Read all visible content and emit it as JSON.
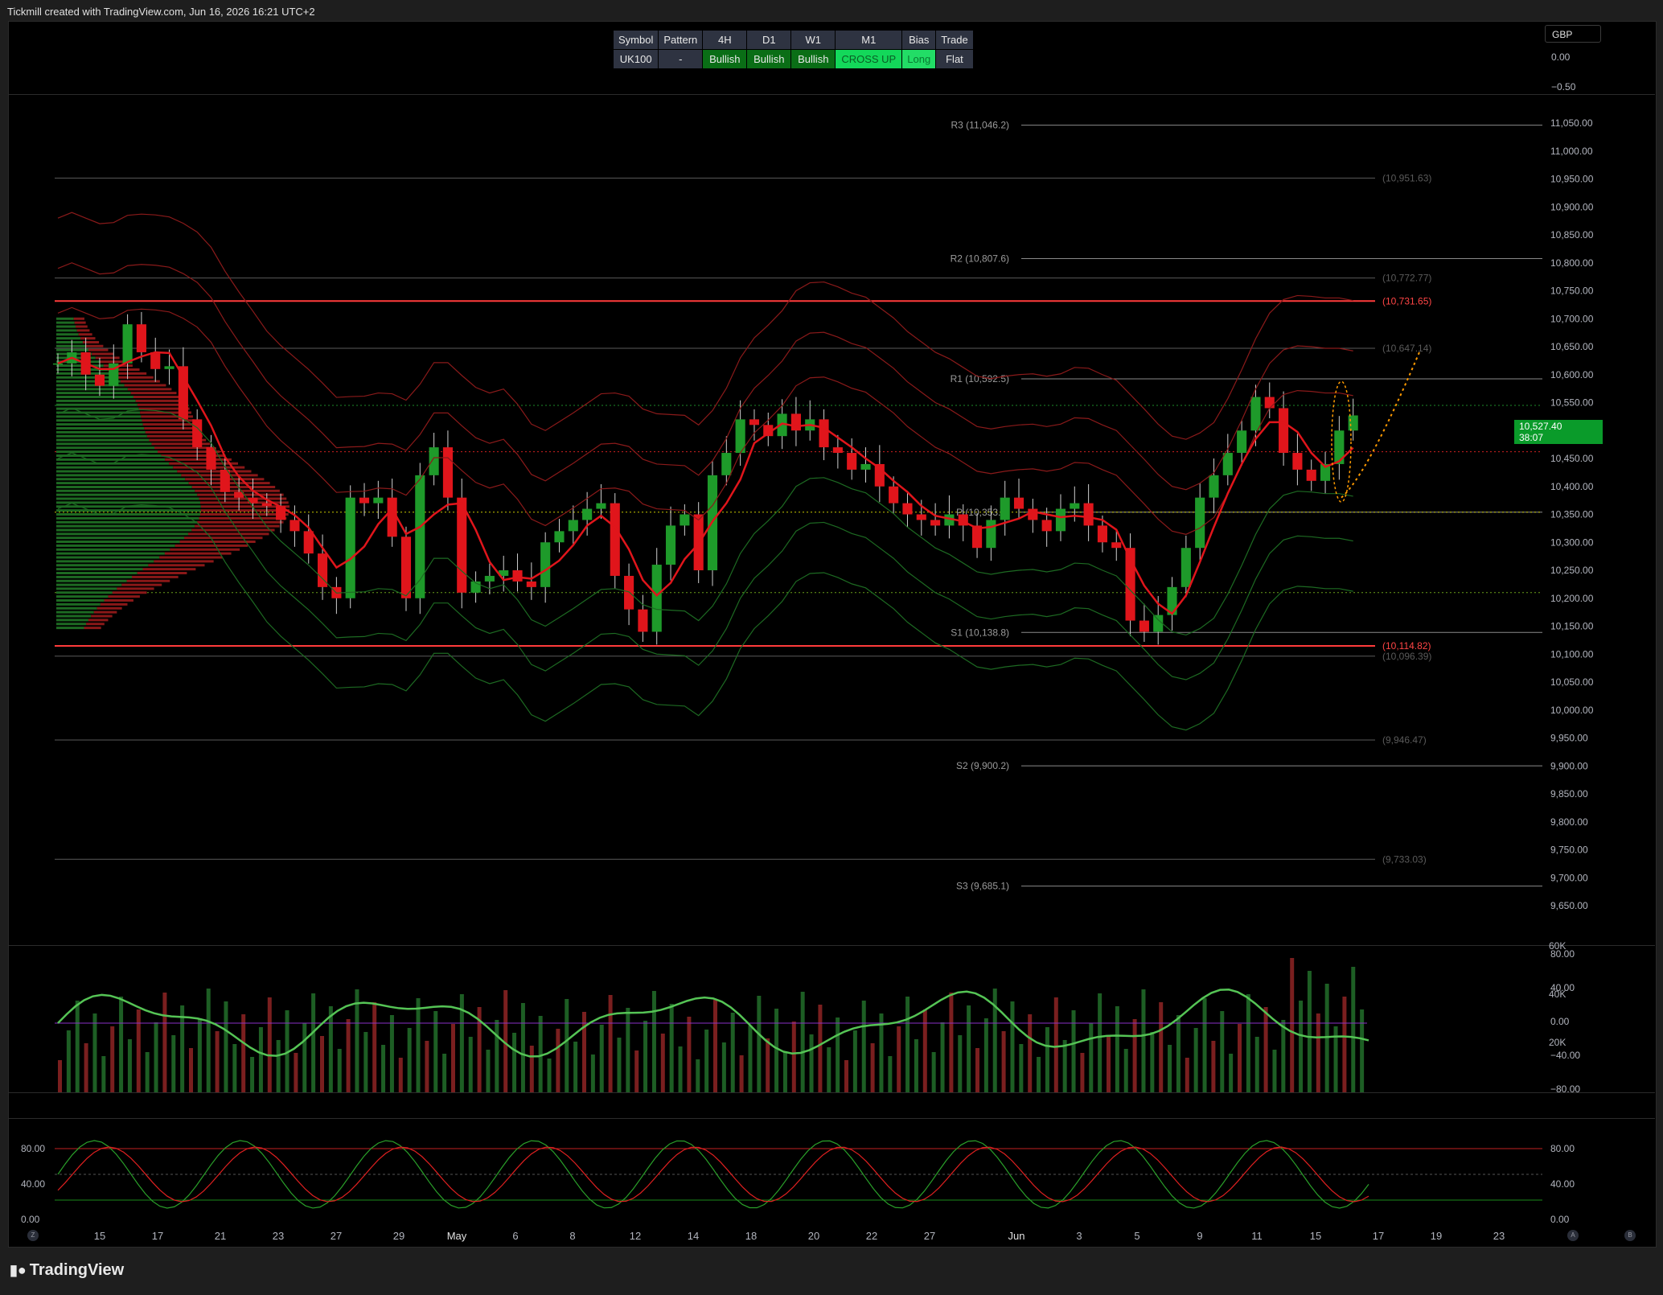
{
  "credit": "Tickmill created with TradingView.com, Jun 16, 2026 16:21 UTC+2",
  "status_table": {
    "headers": [
      "Symbol",
      "Pattern",
      "4H",
      "D1",
      "W1",
      "M1",
      "Bias",
      "Trade"
    ],
    "values": [
      "UK100",
      "-",
      "Bullish",
      "Bullish",
      "Bullish",
      "CROSS UP",
      "Long",
      "Flat"
    ]
  },
  "currency": "GBP",
  "top_pane_ticks": [
    "0.00",
    "−0.50"
  ],
  "price_tag": {
    "price": "10,527.40",
    "countdown": "38:07"
  },
  "logo": "TradingView",
  "scroll_buttons": [
    "Z",
    "A",
    "B"
  ],
  "colors": {
    "bull": "#1e9a2a",
    "bear": "#e0151b",
    "resistance": "#ff3b3b",
    "pivot": "#c8c800"
  },
  "chart_data": [
    {
      "type": "candlestick",
      "symbol": "UK100",
      "ylim": [
        9630,
        11080
      ],
      "y_ticks": [
        "11,050.00",
        "11,000.00",
        "10,950.00",
        "10,900.00",
        "10,850.00",
        "10,800.00",
        "10,750.00",
        "10,700.00",
        "10,650.00",
        "10,600.00",
        "10,550.00",
        "10,500.00",
        "10,450.00",
        "10,400.00",
        "10,350.00",
        "10,300.00",
        "10,250.00",
        "10,200.00",
        "10,150.00",
        "10,100.00",
        "10,050.00",
        "10,000.00",
        "9,950.00",
        "9,900.00",
        "9,850.00",
        "9,800.00",
        "9,750.00",
        "9,700.00",
        "9,650.00"
      ],
      "x_ticks": [
        "15",
        "17",
        "21",
        "23",
        "27",
        "29",
        "May",
        "6",
        "8",
        "12",
        "14",
        "18",
        "20",
        "22",
        "27",
        "Jun",
        "3",
        "5",
        "9",
        "11",
        "15",
        "17",
        "19",
        "23"
      ],
      "pivot_levels": [
        {
          "label": "R3 (11,046.2)",
          "value": 11046.2
        },
        {
          "label": "R2 (10,807.6)",
          "value": 10807.6
        },
        {
          "label": "R1 (10,592.5)",
          "value": 10592.5
        },
        {
          "label": "P (10,353.9)",
          "value": 10353.9
        },
        {
          "label": "S1 (10,138.8)",
          "value": 10138.8
        },
        {
          "label": "S2 (9,900.2)",
          "value": 9900.2
        },
        {
          "label": "S3 (9,685.1)",
          "value": 9685.1
        }
      ],
      "levels": [
        {
          "label": "(10,951.63)",
          "value": 10951.63,
          "color": "#4a4a4a"
        },
        {
          "label": "(10,772.77)",
          "value": 10772.77,
          "color": "#4a4a4a"
        },
        {
          "label": "(10,731.65)",
          "value": 10731.65,
          "color": "#ff3b3b"
        },
        {
          "label": "(10,647.14)",
          "value": 10647.14,
          "color": "#4a4a4a"
        },
        {
          "label": "(10,114.82)",
          "value": 10114.82,
          "color": "#ff3b3b"
        },
        {
          "label": "(10,096.39)",
          "value": 10096.39,
          "color": "#4a4a4a"
        },
        {
          "label": "(9,946.47)",
          "value": 9946.47,
          "color": "#4a4a4a"
        },
        {
          "label": "(9,733.03)",
          "value": 9733.03,
          "color": "#4a4a4a"
        }
      ],
      "close_path": [
        10620,
        10640,
        10600,
        10580,
        10620,
        10690,
        10640,
        10610,
        10615,
        10520,
        10470,
        10430,
        10390,
        10380,
        10370,
        10365,
        10340,
        10320,
        10280,
        10220,
        10200,
        10380,
        10370,
        10380,
        10310,
        10200,
        10420,
        10470,
        10380,
        10210,
        10230,
        10240,
        10250,
        10230,
        10220,
        10300,
        10320,
        10340,
        10360,
        10370,
        10240,
        10180,
        10140,
        10260,
        10330,
        10350,
        10250,
        10420,
        10460,
        10520,
        10510,
        10490,
        10530,
        10500,
        10520,
        10470,
        10460,
        10430,
        10440,
        10400,
        10370,
        10350,
        10340,
        10330,
        10350,
        10330,
        10290,
        10340,
        10380,
        10360,
        10340,
        10320,
        10360,
        10370,
        10330,
        10300,
        10290,
        10160,
        10140,
        10170,
        10220,
        10290,
        10380,
        10420,
        10460,
        10500,
        10560,
        10540,
        10460,
        10430,
        10410,
        10440,
        10500,
        10527
      ],
      "last_price": 10527.4
    },
    {
      "type": "bar+line",
      "name": "volume",
      "right_ticks": [
        "80.00",
        "40.00",
        "0.00",
        "−40.00",
        "−80.00"
      ],
      "left_ticks": [
        "60K",
        "40K",
        "20K"
      ]
    },
    {
      "type": "line",
      "name": "stochastic",
      "ticks": [
        "80.00",
        "40.00",
        "0.00"
      ]
    }
  ]
}
